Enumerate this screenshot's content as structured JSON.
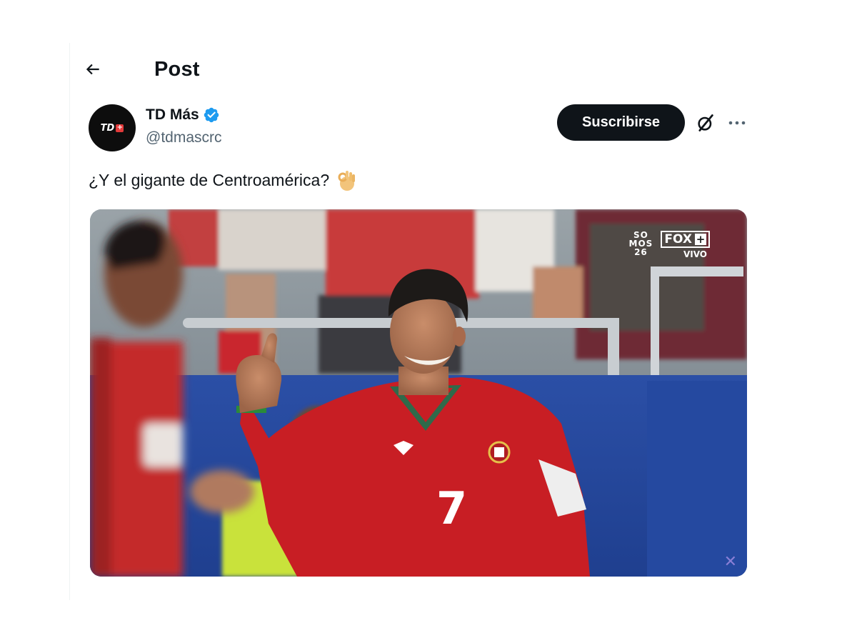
{
  "header": {
    "title": "Post",
    "back_icon": "arrow-left-icon"
  },
  "author": {
    "display_name": "TD Más",
    "handle": "@tdmascrc",
    "verified": true,
    "verified_color": "#1d9bf0",
    "avatar_logo_text": "TD",
    "avatar_logo_plus": "+"
  },
  "actions": {
    "subscribe_label": "Suscribirse",
    "grok_icon": "grok-slash-icon",
    "more_icon": "more-horizontal-icon"
  },
  "post": {
    "text": "¿Y el gigante de Centroamérica?",
    "emoji": "ok-hand-emoji",
    "media": {
      "kind": "video-still",
      "jersey_number": "7",
      "overlay": {
        "sn_logo": "SO MOS 26",
        "fox_text": "FOX",
        "fox_plus": "+",
        "live_label": "VIVO"
      }
    }
  },
  "colors": {
    "text_primary": "#0f1419",
    "text_secondary": "#536471",
    "button_bg": "#0f1419",
    "button_text": "#ffffff",
    "jersey_red": "#c81e24"
  }
}
